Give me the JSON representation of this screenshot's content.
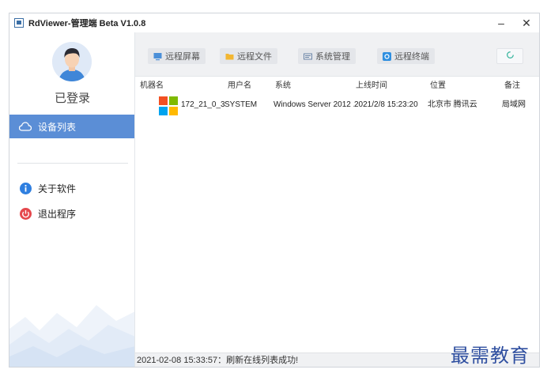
{
  "window": {
    "title": "RdViewer-管理端 Beta V1.0.8",
    "minimize_glyph": "–",
    "close_glyph": "✕"
  },
  "sidebar": {
    "login_status": "已登录",
    "items": [
      {
        "label": "设备列表",
        "icon": "cloud-icon",
        "active": true
      },
      {
        "label": "关于软件",
        "icon": "info-icon",
        "active": false
      },
      {
        "label": "退出程序",
        "icon": "power-icon",
        "active": false
      }
    ]
  },
  "toolbar": {
    "buttons": [
      {
        "label": "远程屏幕",
        "icon": "monitor-icon"
      },
      {
        "label": "远程文件",
        "icon": "folder-icon"
      },
      {
        "label": "系统管理",
        "icon": "system-icon"
      },
      {
        "label": "远程终端",
        "icon": "terminal-icon"
      }
    ],
    "refresh_icon": "refresh-icon"
  },
  "table": {
    "columns": [
      "机器名",
      "用户名",
      "系统",
      "上线时间",
      "位置",
      "备注"
    ],
    "rows": [
      {
        "machine": "172_21_0_3",
        "user": "SYSTEM",
        "os": "Windows Server 2012 ...",
        "online_time": "2021/2/8 15:23:20",
        "location": "北京市 腾讯云",
        "note": "局域网"
      }
    ]
  },
  "statusbar": {
    "message": "2021-02-08 15:33:57：刷新在线列表成功!"
  },
  "watermark": "最需教育",
  "colors": {
    "accent": "#5b8ed6",
    "toolbar_bg": "#f0f1f3",
    "info_blue": "#2f7fe0",
    "power_red": "#e5484d"
  }
}
